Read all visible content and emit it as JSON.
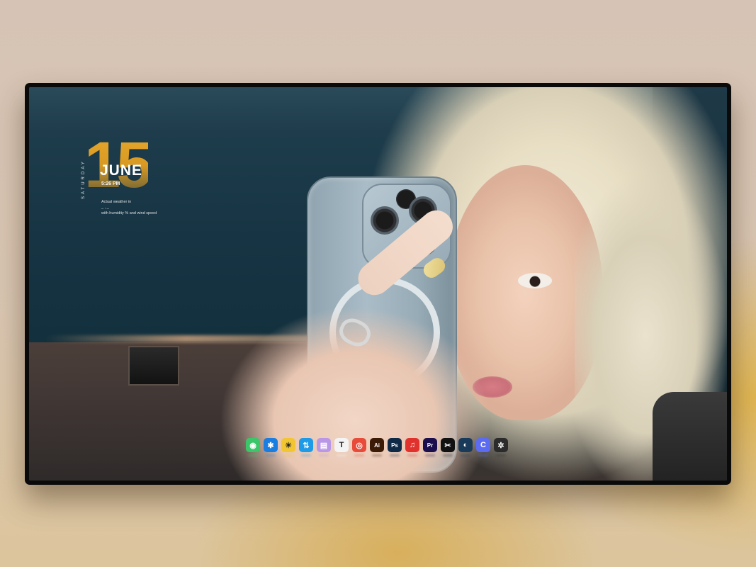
{
  "widget": {
    "day_number": "15",
    "weekday": "SATURDAY",
    "month": "JUNE",
    "time": "5:26 PM",
    "weather_line1": "Actual weather in",
    "weather_line2": "_ , _",
    "weather_line3": "with humidity  % and wind speed"
  },
  "dock": {
    "items": [
      {
        "name": "wechat-icon",
        "glyph": "◉",
        "color": "#3cc66a"
      },
      {
        "name": "star-app-icon",
        "glyph": "✱",
        "color": "#1a7de0"
      },
      {
        "name": "stickies-icon",
        "glyph": "☀",
        "color": "#f2c632"
      },
      {
        "name": "transfer-app-icon",
        "glyph": "⇅",
        "color": "#1e9be8"
      },
      {
        "name": "notes-app-icon",
        "glyph": "▤",
        "color": "#b996e6"
      },
      {
        "name": "typora-icon",
        "glyph": "T",
        "color": "#f4f4f4"
      },
      {
        "name": "chrome-icon",
        "glyph": "◎",
        "color": "#e84b3a"
      },
      {
        "name": "illustrator-icon",
        "glyph": "Ai",
        "color": "#3b1a06"
      },
      {
        "name": "photoshop-icon",
        "glyph": "Ps",
        "color": "#0f2a47"
      },
      {
        "name": "netease-music-icon",
        "glyph": "♫",
        "color": "#e0312d"
      },
      {
        "name": "premiere-icon",
        "glyph": "Pr",
        "color": "#1c0f4e"
      },
      {
        "name": "capcut-icon",
        "glyph": "✂",
        "color": "#111111"
      },
      {
        "name": "steam-icon",
        "glyph": "◐",
        "color": "#1a3a5a"
      },
      {
        "name": "browser-c-icon",
        "glyph": "C",
        "color": "#5b6cf2"
      },
      {
        "name": "aperture-icon",
        "glyph": "✲",
        "color": "#2b2b2b"
      }
    ]
  }
}
